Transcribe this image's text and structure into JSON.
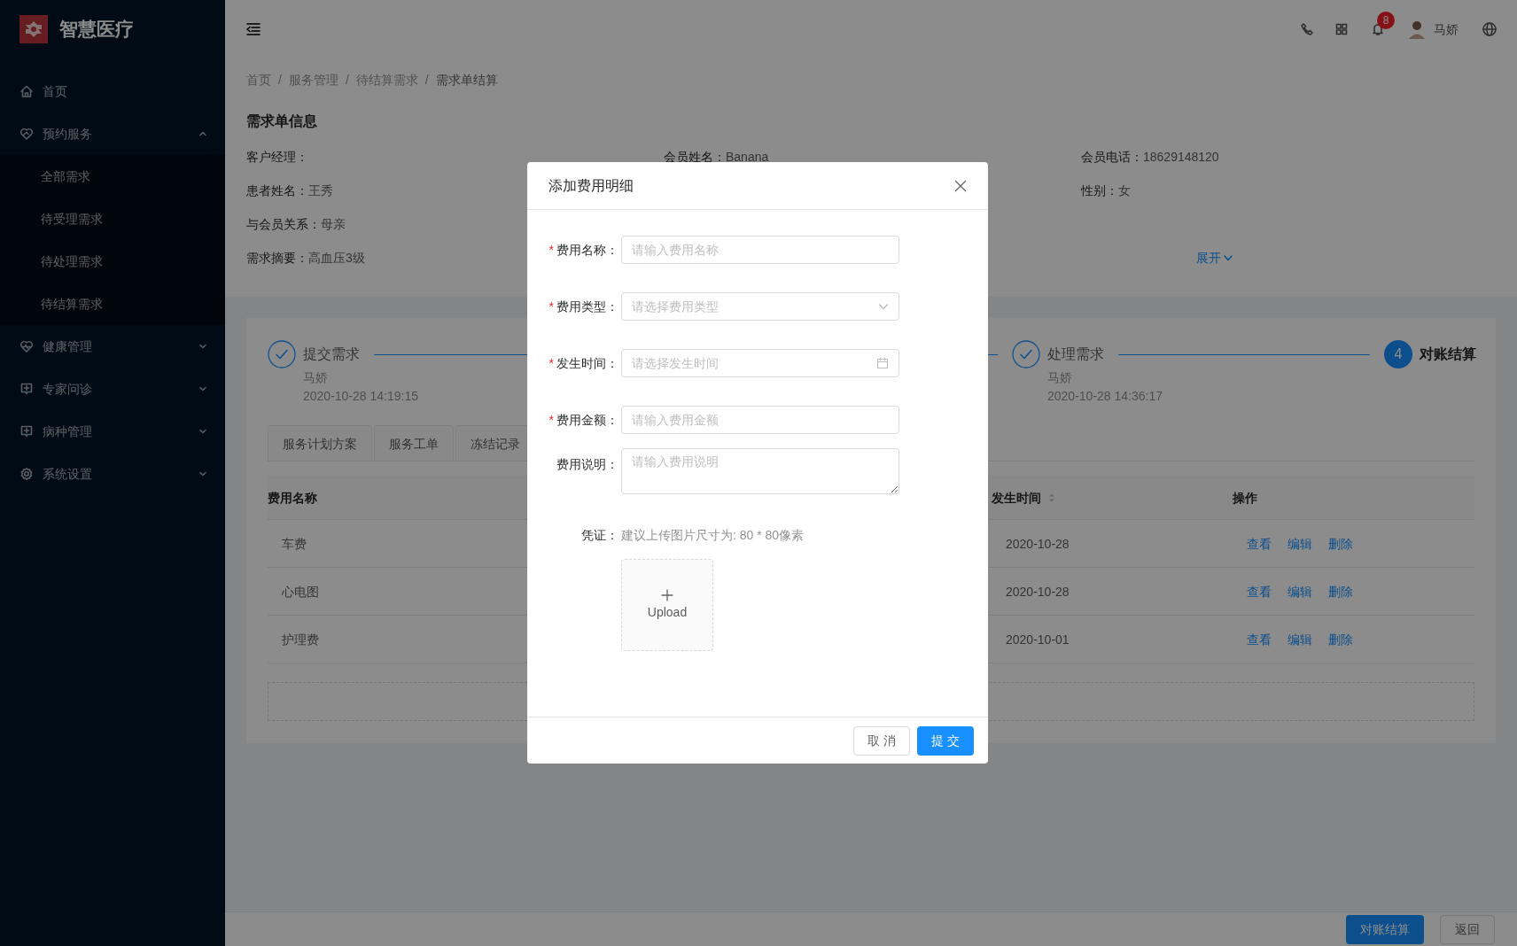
{
  "sidebar": {
    "logo_text": "智慧医疗",
    "items": [
      {
        "label": "首页",
        "kind": "link"
      },
      {
        "label": "预约服务",
        "kind": "submenu",
        "expanded": true,
        "children": [
          {
            "label": "全部需求"
          },
          {
            "label": "待受理需求"
          },
          {
            "label": "待处理需求"
          },
          {
            "label": "待结算需求"
          }
        ]
      },
      {
        "label": "健康管理",
        "kind": "submenu",
        "expanded": false
      },
      {
        "label": "专家问诊",
        "kind": "submenu",
        "expanded": false
      },
      {
        "label": "病种管理",
        "kind": "submenu",
        "expanded": false
      },
      {
        "label": "系统设置",
        "kind": "submenu",
        "expanded": false
      }
    ]
  },
  "header": {
    "badge_count": "8",
    "user_name": "马娇"
  },
  "breadcrumb": [
    {
      "label": "首页"
    },
    {
      "separator": "/",
      "label": "服务管理"
    },
    {
      "separator": "/",
      "label": "待结算需求"
    },
    {
      "separator": "/",
      "label": "需求单结算"
    }
  ],
  "info": {
    "title": "需求单信息",
    "rows": [
      [
        {
          "label": "客户经理："
        },
        {
          "label": "会员姓名：",
          "value": "Banana"
        },
        {
          "label": "会员电话：",
          "value": "18629148120"
        }
      ],
      [
        {
          "label": "患者姓名：",
          "value": "王秀"
        },
        null,
        {
          "label": "性别：",
          "value": "女"
        }
      ],
      [
        {
          "label": "与会员关系：",
          "value": "母亲"
        },
        null,
        null
      ]
    ],
    "summary": {
      "label": "需求摘要：",
      "value": "高血压3级"
    },
    "expand_link": "展开"
  },
  "steps": [
    {
      "finished": true,
      "title": "提交需求",
      "person": "马娇",
      "time": "2020-10-28 14:19:15"
    },
    {
      "finished": true
    },
    {
      "finished": true,
      "title": "处理需求",
      "person": "马娇",
      "time": "2020-10-28 14:36:17"
    },
    {
      "finished": false,
      "number": "4",
      "title": "对账结算"
    }
  ],
  "tabs": [
    {
      "label": "服务计划方案"
    },
    {
      "label": "服务工单"
    },
    {
      "label": "冻结记录"
    }
  ],
  "table": {
    "columns": [
      {
        "label": "费用名称",
        "sortable": false
      },
      {
        "label": "发生时间",
        "sortable": true
      },
      {
        "label": "操作",
        "sortable": false
      }
    ],
    "rows": [
      {
        "name": "车费",
        "date": "2020-10-28",
        "actions": [
          "查看",
          "编辑",
          "删除"
        ]
      },
      {
        "name": "心电图",
        "date": "2020-10-28",
        "actions": [
          "查看",
          "编辑",
          "删除"
        ]
      },
      {
        "name": "护理费",
        "date": "2020-10-01",
        "actions": [
          "查看",
          "编辑",
          "删除"
        ]
      }
    ]
  },
  "footer": {
    "buttons": [
      {
        "label": "对账结算",
        "kind": "primary"
      },
      {
        "label": "返回",
        "kind": "default"
      }
    ]
  },
  "modal": {
    "title": "添加费用明细",
    "fields": [
      {
        "required_mark": "*",
        "label": "费用名称：",
        "kind": "input",
        "placeholder": "请输入费用名称"
      },
      {
        "required_mark": "*",
        "label": "费用类型：",
        "kind": "select",
        "placeholder": "请选择费用类型"
      },
      {
        "required_mark": "*",
        "label": "发生时间：",
        "kind": "date",
        "placeholder": "请选择发生时间"
      },
      {
        "required_mark": "*",
        "label": "费用金额：",
        "kind": "input",
        "placeholder": "请输入费用金额"
      },
      {
        "label": "费用说明：",
        "kind": "textarea",
        "placeholder": "请输入费用说明"
      }
    ],
    "upload": {
      "label": "凭证：",
      "hint": "建议上传图片尺寸为: 80 * 80像素",
      "button": "Upload"
    },
    "buttons": [
      {
        "label": "取 消",
        "kind": "default"
      },
      {
        "label": "提 交",
        "kind": "primary"
      }
    ]
  }
}
